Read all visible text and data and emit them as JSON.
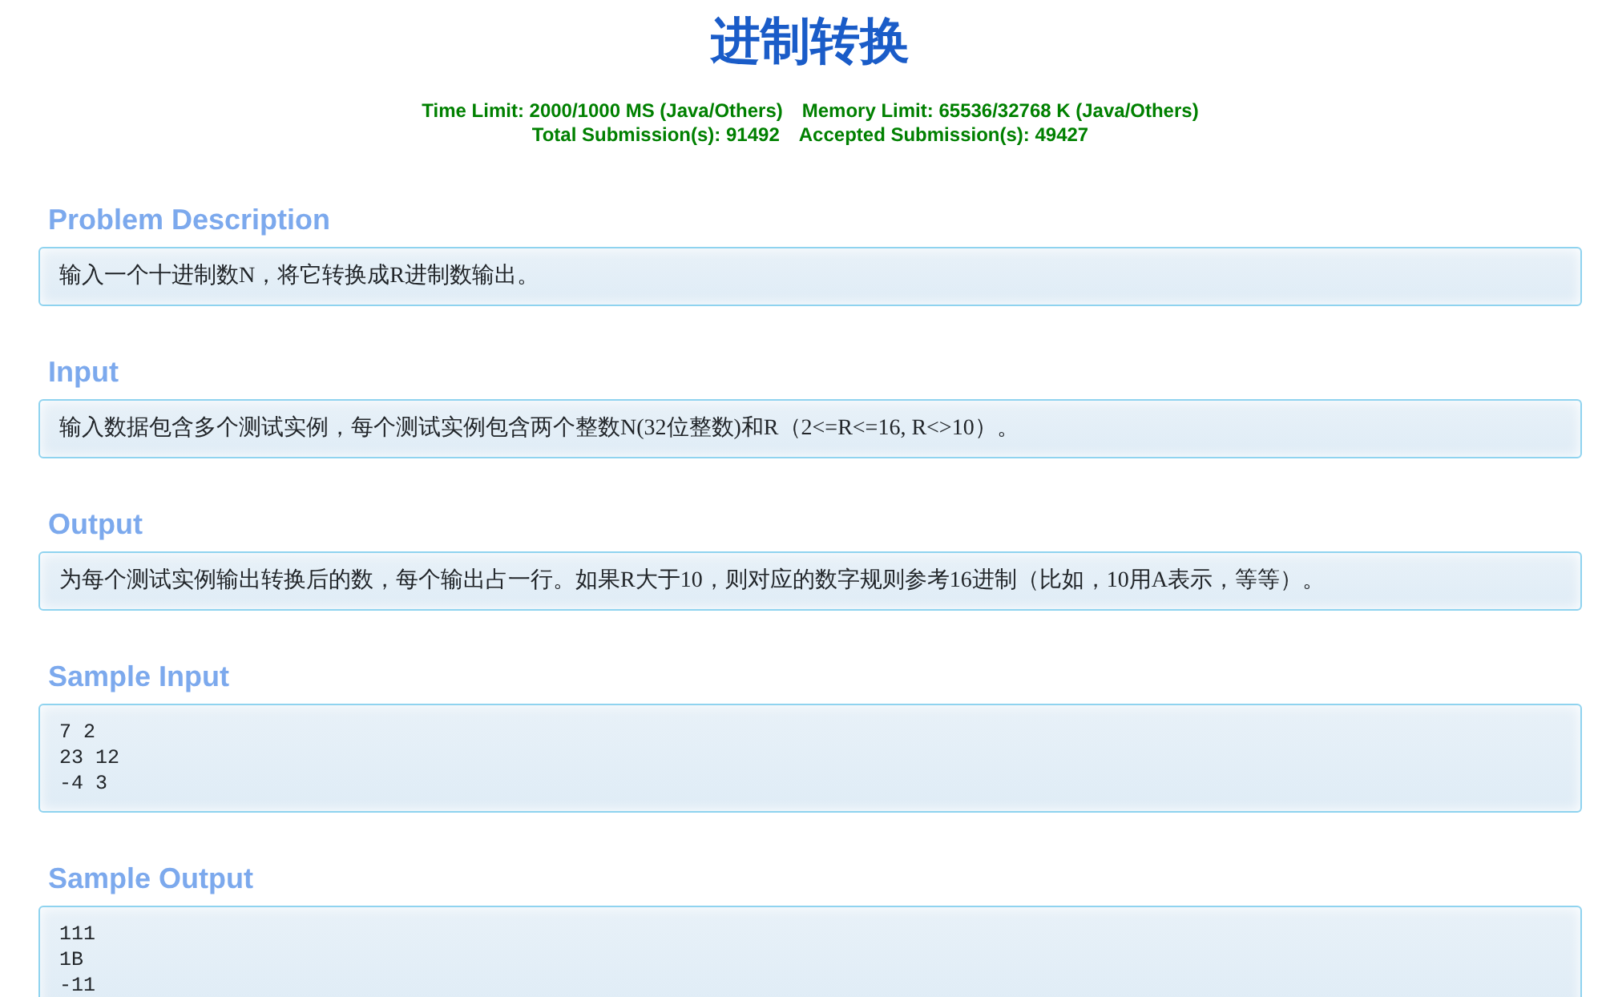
{
  "title": "进制转换",
  "limits": [
    "Time Limit: 2000/1000 MS (Java/Others)",
    "Memory Limit: 65536/32768 K (Java/Others)"
  ],
  "submissions": [
    "Total Submission(s): 91492",
    "Accepted Submission(s): 49427"
  ],
  "sections": [
    {
      "heading": "Problem Description",
      "kind": "text",
      "lines": [
        "输入一个十进制数N，将它转换成R进制数输出。"
      ]
    },
    {
      "heading": "Input",
      "kind": "text",
      "lines": [
        "输入数据包含多个测试实例，每个测试实例包含两个整数N(32位整数)和R（2<=R<=16, R<>10）。"
      ]
    },
    {
      "heading": "Output",
      "kind": "text",
      "lines": [
        "为每个测试实例输出转换后的数，每个输出占一行。如果R大于10，则对应的数字规则参考16进制（比如，10用A表示，等等）。"
      ]
    },
    {
      "heading": "Sample Input",
      "kind": "code",
      "lines": [
        "7 2",
        "23 12",
        "-4 3"
      ]
    },
    {
      "heading": "Sample Output",
      "kind": "code",
      "lines": [
        "111",
        "1B",
        "-11"
      ]
    }
  ]
}
